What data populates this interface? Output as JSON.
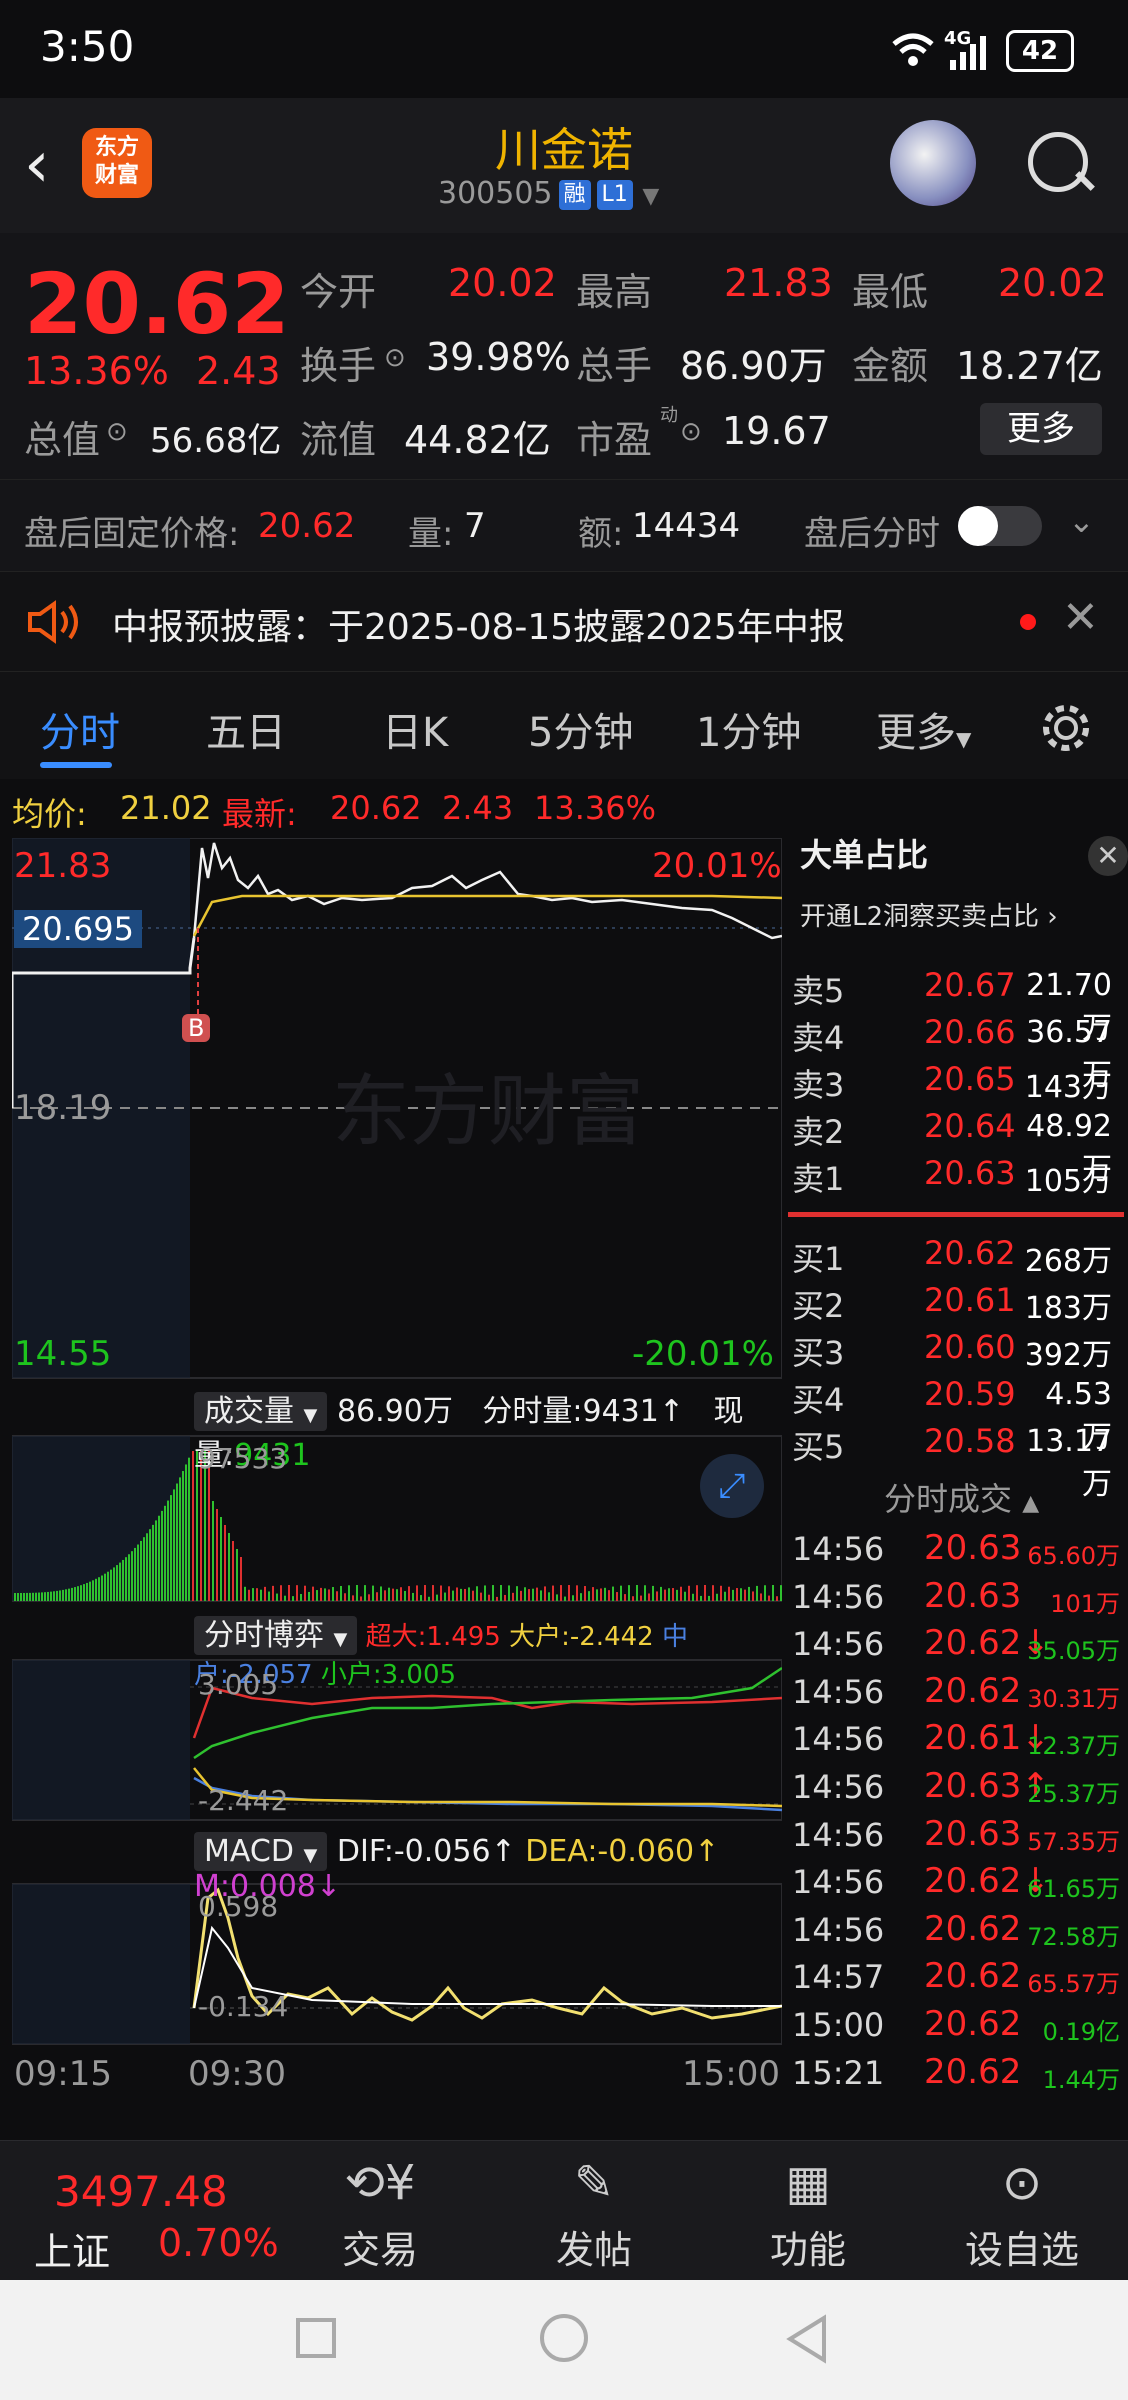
{
  "status": {
    "time": "3:50",
    "network": "4G",
    "battery": "42"
  },
  "header": {
    "logo_line1": "东方",
    "logo_line2": "财富",
    "name": "川金诺",
    "code": "300505",
    "tag_margin": "融",
    "tag_level": "L1"
  },
  "quote": {
    "price": "20.62",
    "change_pct": "13.36%",
    "change": "2.43",
    "open_label": "今开",
    "open": "20.02",
    "high_label": "最高",
    "high": "21.83",
    "low_label": "最低",
    "low": "20.02",
    "turnover_label": "换手",
    "turnover": "39.98%",
    "volume_label": "总手",
    "volume": "86.90万",
    "amount_label": "金额",
    "amount": "18.27亿",
    "mktcap_label": "总值",
    "mktcap": "56.68亿",
    "float_label": "流值",
    "float": "44.82亿",
    "pe_label": "市盈",
    "pe_sup": "动",
    "pe": "19.67",
    "more": "更多"
  },
  "after_hours": {
    "price_label": "盘后固定价格:",
    "price": "20.62",
    "vol_label": "量:",
    "vol": "7",
    "amount_label": "额:",
    "amount": "14434",
    "toggle_label": "盘后分时"
  },
  "notice": {
    "text": "中报预披露：于2025-08-15披露2025年中报"
  },
  "tabs": [
    "分时",
    "五日",
    "日K",
    "5分钟",
    "1分钟",
    "更多"
  ],
  "avgrow": {
    "avg_label": "均价:",
    "avg": "21.02",
    "latest_label": "最新:",
    "latest": "20.62",
    "chg": "2.43",
    "pct": "13.36%"
  },
  "chart": {
    "y_top": "21.83",
    "y_mid": "18.19",
    "y_bot": "14.55",
    "pct_top": "20.01%",
    "pct_bot": "-20.01%",
    "cursor_price": "20.695",
    "marker": "B",
    "watermark": "东方财富",
    "vol_btn": "成交量",
    "vol_total": "86.90万",
    "vol_min_label": "分时量:",
    "vol_min": "9431",
    "vol_now_label": "现量:",
    "vol_now": "9431",
    "vol_peak": "97533",
    "flow_btn": "分时博弈",
    "flow_super": "超大:1.495",
    "flow_big": "大户:-2.442",
    "flow_mid": "中户:-2.057",
    "flow_small": "小户:3.005",
    "flow_top": "3.005",
    "flow_bot": "-2.442",
    "macd_btn": "MACD",
    "dif": "DIF:-0.056",
    "dea": "DEA:-0.060",
    "m": "M:0.008",
    "macd_top": "0.598",
    "macd_bot": "-0.134",
    "x_start": "09:15",
    "x_open": "09:30",
    "x_end": "15:00"
  },
  "orderbook": {
    "title": "大单占比",
    "l2_text": "开通L2洞察买卖占比",
    "asks": [
      {
        "label": "卖5",
        "price": "20.67",
        "vol": "21.70万"
      },
      {
        "label": "卖4",
        "price": "20.66",
        "vol": "36.57万"
      },
      {
        "label": "卖3",
        "price": "20.65",
        "vol": "143万"
      },
      {
        "label": "卖2",
        "price": "20.64",
        "vol": "48.92万"
      },
      {
        "label": "卖1",
        "price": "20.63",
        "vol": "105万"
      }
    ],
    "bids": [
      {
        "label": "买1",
        "price": "20.62",
        "vol": "268万"
      },
      {
        "label": "买2",
        "price": "20.61",
        "vol": "183万"
      },
      {
        "label": "买3",
        "price": "20.60",
        "vol": "392万"
      },
      {
        "label": "买4",
        "price": "20.59",
        "vol": "4.53万"
      },
      {
        "label": "买5",
        "price": "20.58",
        "vol": "13.17万"
      }
    ],
    "trades_title": "分时成交",
    "trades": [
      {
        "time": "14:56",
        "price": "20.63",
        "vol": "65.60万",
        "dir": ""
      },
      {
        "time": "14:56",
        "price": "20.63",
        "vol": "101万",
        "dir": ""
      },
      {
        "time": "14:56",
        "price": "20.62",
        "vol": "35.05万",
        "dir": "↓"
      },
      {
        "time": "14:56",
        "price": "20.62",
        "vol": "30.31万",
        "dir": ""
      },
      {
        "time": "14:56",
        "price": "20.61",
        "vol": "12.37万",
        "dir": "↓"
      },
      {
        "time": "14:56",
        "price": "20.63",
        "vol": "25.37万",
        "dir": "↑"
      },
      {
        "time": "14:56",
        "price": "20.63",
        "vol": "57.35万",
        "dir": ""
      },
      {
        "time": "14:56",
        "price": "20.62",
        "vol": "61.65万",
        "dir": "↓"
      },
      {
        "time": "14:56",
        "price": "20.62",
        "vol": "72.58万",
        "dir": ""
      },
      {
        "time": "14:57",
        "price": "20.62",
        "vol": "65.57万",
        "dir": ""
      },
      {
        "time": "15:00",
        "price": "20.62",
        "vol": "0.19亿",
        "dir": ""
      },
      {
        "time": "15:21",
        "price": "20.62",
        "vol": "1.44万",
        "dir": ""
      }
    ]
  },
  "bottomnav": {
    "index_value": "3497.48",
    "index_name": "上证",
    "index_pct": "0.70%",
    "trade": "交易",
    "post": "发帖",
    "func": "功能",
    "watch": "设自选"
  }
}
